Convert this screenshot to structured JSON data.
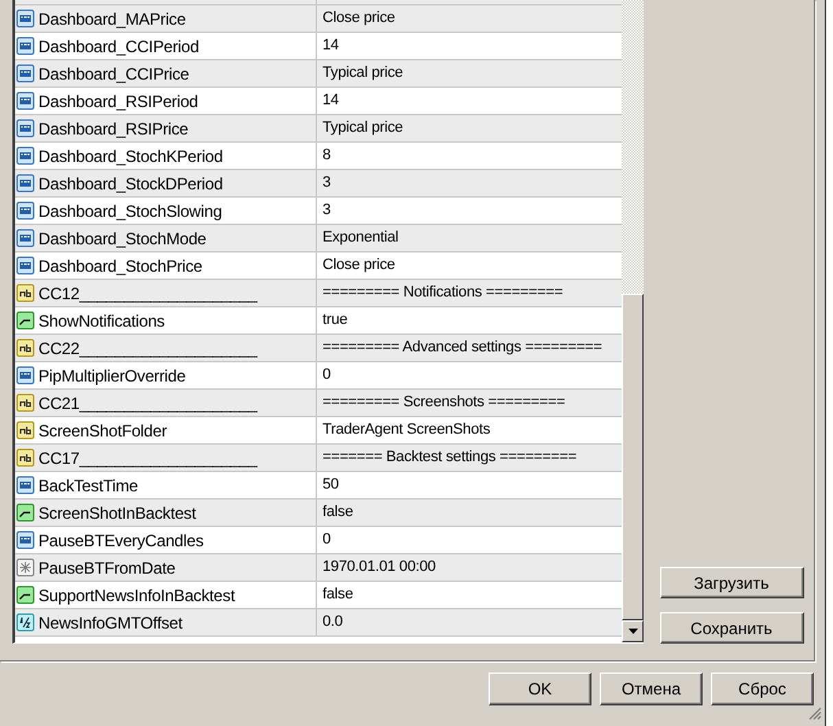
{
  "parameters": [
    {
      "kind": "int",
      "name": "Dashboard_MAPrice",
      "value": "Close price"
    },
    {
      "kind": "int",
      "name": "Dashboard_CCIPeriod",
      "value": "14"
    },
    {
      "kind": "int",
      "name": "Dashboard_CCIPrice",
      "value": "Typical price"
    },
    {
      "kind": "int",
      "name": "Dashboard_RSIPeriod",
      "value": "14"
    },
    {
      "kind": "int",
      "name": "Dashboard_RSIPrice",
      "value": "Typical price"
    },
    {
      "kind": "int",
      "name": "Dashboard_StochKPeriod",
      "value": "8"
    },
    {
      "kind": "int",
      "name": "Dashboard_StockDPeriod",
      "value": "3"
    },
    {
      "kind": "int",
      "name": "Dashboard_StochSlowing",
      "value": "3"
    },
    {
      "kind": "int",
      "name": "Dashboard_StochMode",
      "value": "Exponential"
    },
    {
      "kind": "int",
      "name": "Dashboard_StochPrice",
      "value": "Close price"
    },
    {
      "kind": "string",
      "name": "CC12____________________",
      "value": "========= Notifications ========="
    },
    {
      "kind": "bool",
      "name": "ShowNotifications",
      "value": "true"
    },
    {
      "kind": "string",
      "name": "CC22____________________",
      "value": "========= Advanced settings ========="
    },
    {
      "kind": "int",
      "name": "PipMultiplierOverride",
      "value": "0"
    },
    {
      "kind": "string",
      "name": "CC21____________________",
      "value": "========= Screenshots ========="
    },
    {
      "kind": "string",
      "name": "ScreenShotFolder",
      "value": "TraderAgent ScreenShots"
    },
    {
      "kind": "string",
      "name": "CC17____________________",
      "value": "======= Backtest settings ========="
    },
    {
      "kind": "int",
      "name": "BackTestTime",
      "value": "50"
    },
    {
      "kind": "bool",
      "name": "ScreenShotInBacktest",
      "value": "false"
    },
    {
      "kind": "int",
      "name": "PauseBTEveryCandles",
      "value": "0"
    },
    {
      "kind": "datetime",
      "name": "PauseBTFromDate",
      "value": "1970.01.01 00:00"
    },
    {
      "kind": "bool",
      "name": "SupportNewsInfoInBacktest",
      "value": "false"
    },
    {
      "kind": "double",
      "name": "NewsInfoGMTOffset",
      "value": "0.0"
    }
  ],
  "side_buttons": [
    "Загрузить",
    "Сохранить"
  ],
  "buttons": [
    "OK",
    "Отмена",
    "Сброс"
  ]
}
